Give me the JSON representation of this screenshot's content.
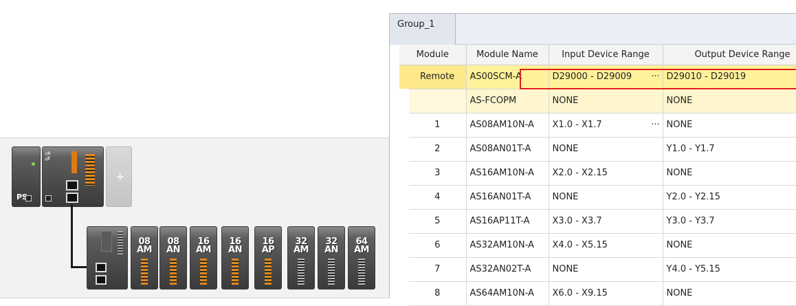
{
  "hardware": {
    "ps_label": "PS",
    "cpu_led_labels": "R\nE",
    "add_slot_symbol": "+",
    "io_modules": [
      "08\nAM",
      "08\nAN",
      "16\nAM",
      "16\nAN",
      "16\nAP",
      "32\nAM",
      "32\nAN",
      "64\nAM"
    ]
  },
  "tab": {
    "label": "Group_1"
  },
  "grid": {
    "headers": [
      "Module",
      "Module Name",
      "Input Device Range",
      "Output Device Range"
    ],
    "remote": {
      "module": "Remote",
      "name": "AS00SCM-A",
      "input": "D29000 - D29009",
      "output": "D29010 - D29019",
      "input_more": "···"
    },
    "sub": {
      "name": "AS-FCOPM",
      "input": "NONE",
      "output": "NONE"
    },
    "rows": [
      {
        "module": "1",
        "name": "AS08AM10N-A",
        "input": "X1.0 - X1.7",
        "output": "NONE",
        "more": "···"
      },
      {
        "module": "2",
        "name": "AS08AN01T-A",
        "input": "NONE",
        "output": "Y1.0 - Y1.7",
        "more": "··"
      },
      {
        "module": "3",
        "name": "AS16AM10N-A",
        "input": "X2.0 - X2.15",
        "output": "NONE",
        "more": ""
      },
      {
        "module": "4",
        "name": "AS16AN01T-A",
        "input": "NONE",
        "output": "Y2.0 - Y2.15",
        "more": ""
      },
      {
        "module": "5",
        "name": "AS16AP11T-A",
        "input": "X3.0 - X3.7",
        "output": "Y3.0 - Y3.7",
        "more": ""
      },
      {
        "module": "6",
        "name": "AS32AM10N-A",
        "input": "X4.0 - X5.15",
        "output": "NONE",
        "more": ""
      },
      {
        "module": "7",
        "name": "AS32AN02T-A",
        "input": "NONE",
        "output": "Y4.0 - Y5.15",
        "more": ""
      },
      {
        "module": "8",
        "name": "AS64AM10N-A",
        "input": "X6.0 - X9.15",
        "output": "NONE",
        "more": ""
      }
    ]
  }
}
